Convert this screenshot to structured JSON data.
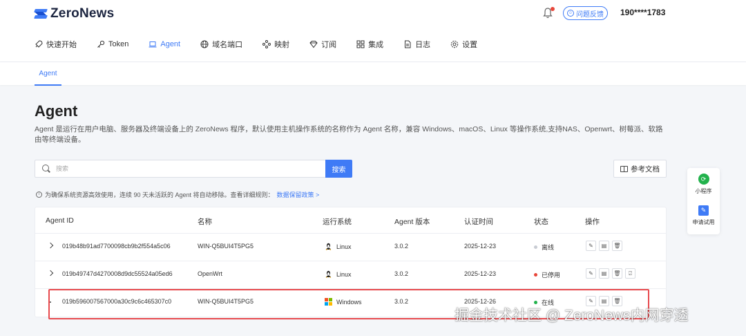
{
  "brand": {
    "name": "ZeroNews"
  },
  "header": {
    "feedback_label": "问题反馈",
    "user": "190****1783"
  },
  "nav": [
    {
      "label": "快速开始",
      "icon": "rocket-icon"
    },
    {
      "label": "Token",
      "icon": "key-icon"
    },
    {
      "label": "Agent",
      "icon": "laptop-icon",
      "active": true
    },
    {
      "label": "域名端口",
      "icon": "globe-icon"
    },
    {
      "label": "映射",
      "icon": "share-nodes-icon"
    },
    {
      "label": "订阅",
      "icon": "diamond-icon"
    },
    {
      "label": "集成",
      "icon": "grid-icon"
    },
    {
      "label": "日志",
      "icon": "file-icon"
    },
    {
      "label": "设置",
      "icon": "gear-icon"
    }
  ],
  "subtab": "Agent",
  "page": {
    "title": "Agent",
    "description": "Agent 是运行在用户电脑、服务器及终端设备上的 ZeroNews 程序，默认使用主机操作系统的名称作为 Agent 名称，兼容 Windows、macOS、Linux 等操作系统,支持NAS、Openwrt、树莓派、软路由等终端设备。"
  },
  "search": {
    "placeholder": "搜索",
    "button": "搜索"
  },
  "doc_button": "参考文档",
  "notice": {
    "text": "为确保系统资源高效使用，连续 90 天未活跃的 Agent 将自动移除。查看详细规则：",
    "link": "数据保留政策 >"
  },
  "table": {
    "columns": [
      "Agent ID",
      "名称",
      "运行系统",
      "Agent 版本",
      "认证时间",
      "状态",
      "操作"
    ],
    "rows": [
      {
        "id": "019b48b91ad7700098cb9b2f554a5c06",
        "name": "WIN-Q5BUI4T5PG5",
        "os": "Linux",
        "version": "3.0.2",
        "auth_time": "2025-12-23",
        "status": "离线",
        "status_color": "#c8ccd3",
        "expandable": true,
        "ops": 3
      },
      {
        "id": "019b49747d4270008d9dc55524a05ed6",
        "name": "OpenWrt",
        "os": "Linux",
        "version": "3.0.2",
        "auth_time": "2025-12-23",
        "status": "已停用",
        "status_color": "#e8463a",
        "expandable": true,
        "ops": 4
      },
      {
        "id": "019b596007567000a30c9c6c465307c0",
        "name": "WIN-Q5BUI4T5PG5",
        "os": "Windows",
        "version": "3.0.2",
        "auth_time": "2025-12-26",
        "status": "在线",
        "status_color": "#22b24c",
        "expandable": false,
        "ops": 3
      }
    ]
  },
  "float": [
    {
      "label": "小程序",
      "icon": "mini-program-icon"
    },
    {
      "label": "申请试用",
      "icon": "edit-icon"
    }
  ],
  "watermark": "掘金技术社区 @ ZeroNews内网穿透",
  "colors": {
    "accent": "#3f7bf6",
    "offline": "#c8ccd3",
    "disabled": "#e8463a",
    "online": "#22b24c",
    "highlight": "#e8494d"
  }
}
